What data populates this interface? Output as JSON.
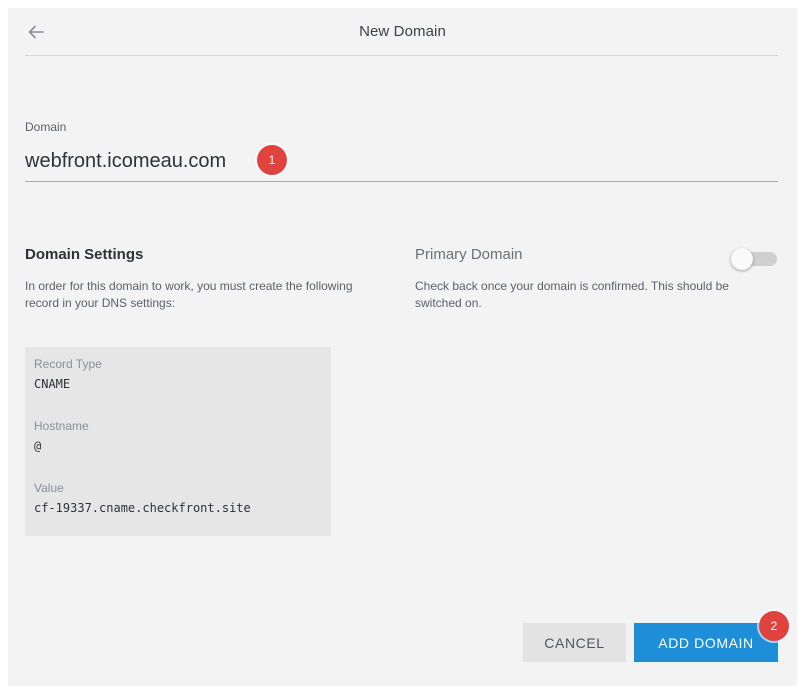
{
  "header": {
    "title": "New Domain",
    "back_icon": "arrow-left-icon"
  },
  "domain": {
    "label": "Domain",
    "value": "webfront.icomeau.com"
  },
  "annotations": {
    "badge_1": "1",
    "badge_2": "2",
    "badge_color": "#e0423d"
  },
  "settings": {
    "title": "Domain Settings",
    "description": "In order for this domain to work, you must create the following record in your DNS settings:",
    "records": [
      {
        "label": "Record Type",
        "value": "CNAME"
      },
      {
        "label": "Hostname",
        "value": "@"
      },
      {
        "label": "Value",
        "value": "cf-19337.cname.checkfront.site"
      }
    ]
  },
  "primary_domain": {
    "title": "Primary Domain",
    "description": "Check back once your domain is confirmed. This should be switched on.",
    "enabled": false
  },
  "actions": {
    "cancel_label": "CANCEL",
    "add_label": "ADD DOMAIN",
    "accent_color": "#1e8ed9"
  }
}
